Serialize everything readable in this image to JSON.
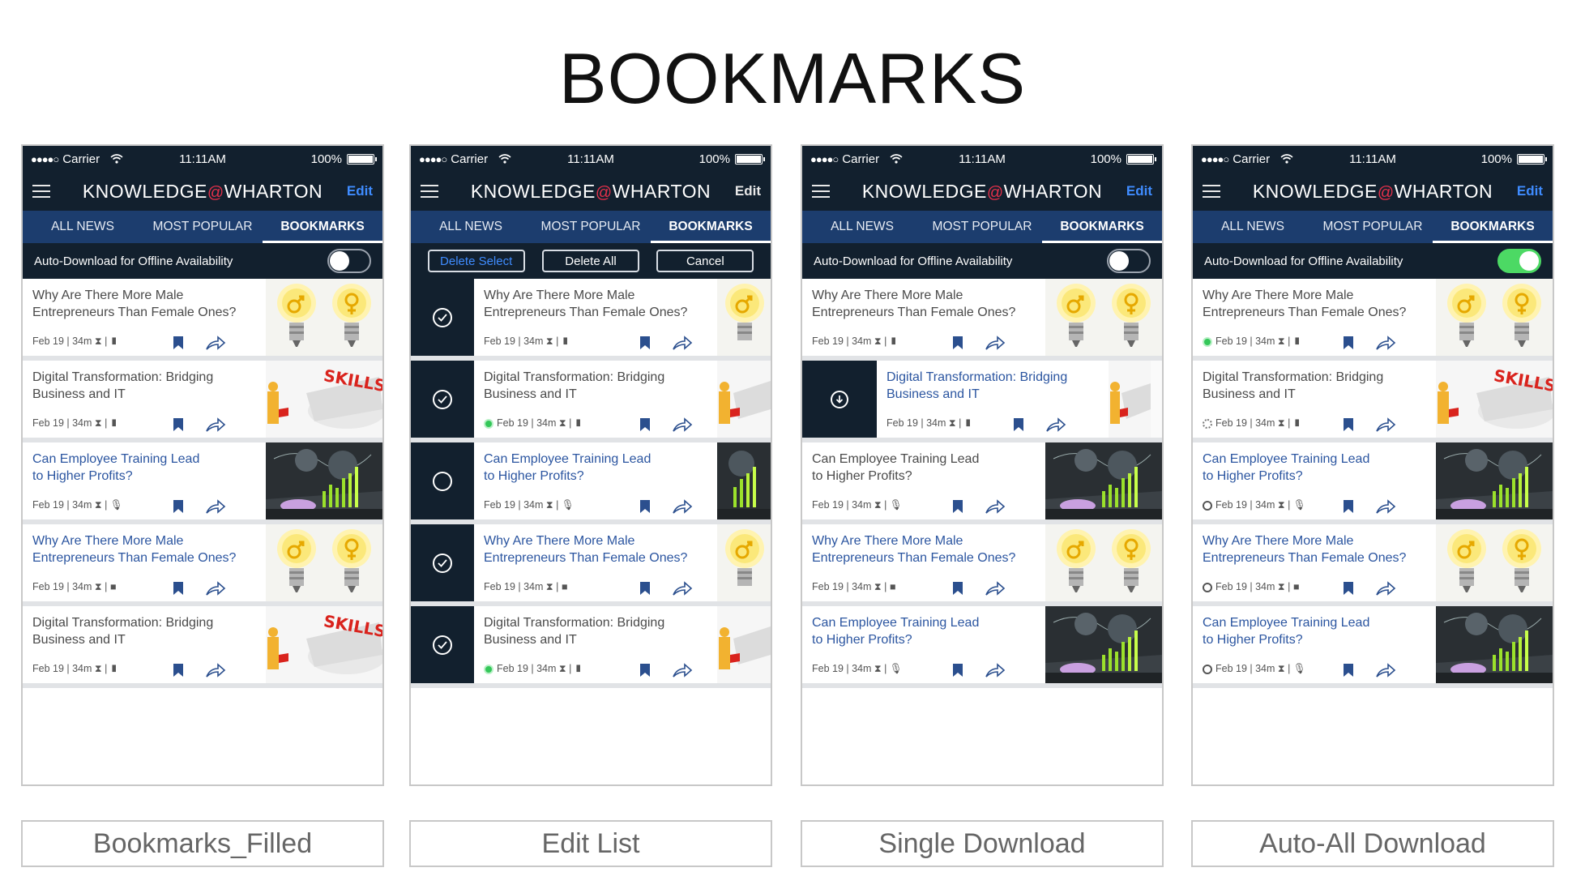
{
  "page_title": "BOOKMARKS",
  "status_bar": {
    "carrier": "Carrier",
    "time": "11:11AM",
    "battery": "100%"
  },
  "app_header": {
    "brand_left": "KNOWLEDGE",
    "brand_at": "@",
    "brand_right": "WHARTON",
    "edit_label": "Edit"
  },
  "tabs": [
    "ALL NEWS",
    "MOST POPULAR",
    "BOOKMARKS"
  ],
  "auto_download_label": "Auto-Download for Offline Availability",
  "edit_actions": {
    "delete_select": "Delete Select",
    "delete_all": "Delete All",
    "cancel": "Cancel"
  },
  "articles": {
    "a1": {
      "title_1": "Why Are There More Male",
      "title_2": "Entrepreneurs Than Female Ones?",
      "meta": "Feb 19 | 34m ⧗ | ▮"
    },
    "a2": {
      "title_1": "Digital Transformation: Bridging",
      "title_2": "Business and IT",
      "meta": "Feb 19 | 34m ⧗ | ▮"
    },
    "a3": {
      "title_1": "Can Employee Training Lead",
      "title_2": "to Higher Profits?",
      "meta": "Feb 19 | 34m ⧗ | 🎙"
    },
    "a4": {
      "title_1": "Why Are There More Male",
      "title_2": "Entrepreneurs Than Female Ones?",
      "meta": "Feb 19 | 34m ⧗ | ■"
    }
  },
  "captions": [
    "Bookmarks_Filled",
    "Edit List",
    "Single Download",
    "Auto-All Download"
  ],
  "colors": {
    "dark_navy": "#12202e",
    "tab_blue": "#1c3d6e",
    "link_blue": "#2b55a0",
    "brand_red": "#e5304a",
    "toggle_green": "#4cd964"
  }
}
